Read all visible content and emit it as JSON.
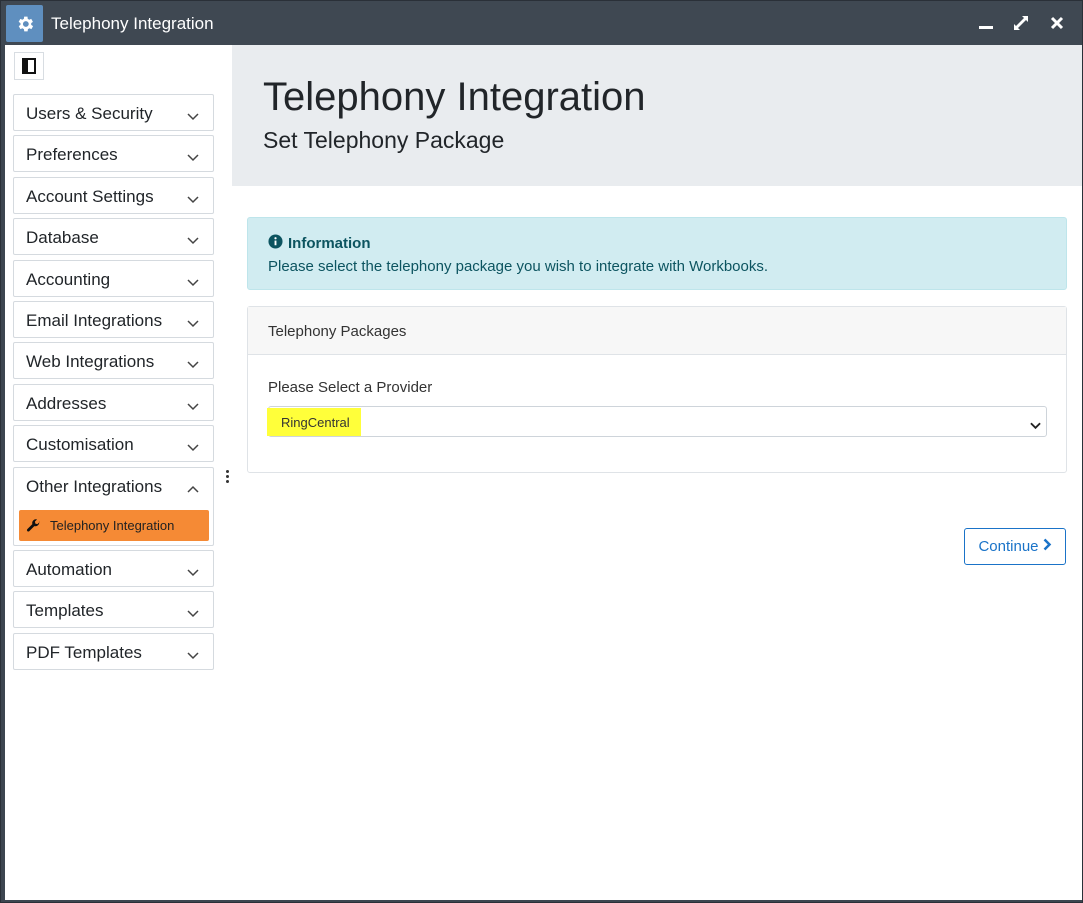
{
  "window": {
    "title": "Telephony Integration"
  },
  "sidebar": {
    "items": [
      {
        "label": "Users & Security"
      },
      {
        "label": "Preferences"
      },
      {
        "label": "Account Settings"
      },
      {
        "label": "Database"
      },
      {
        "label": "Accounting"
      },
      {
        "label": "Email Integrations"
      },
      {
        "label": "Web Integrations"
      },
      {
        "label": "Addresses"
      },
      {
        "label": "Customisation"
      }
    ],
    "expanded_group": {
      "label": "Other Integrations",
      "active_child": "Telephony Integration"
    },
    "items_after": [
      {
        "label": "Automation"
      },
      {
        "label": "Templates"
      },
      {
        "label": "PDF Templates"
      }
    ]
  },
  "main": {
    "title": "Telephony Integration",
    "subtitle": "Set Telephony Package",
    "info": {
      "title": "Information",
      "text": "Please select the telephony package you wish to integrate with Workbooks."
    },
    "card": {
      "header": "Telephony Packages",
      "field_label": "Please Select a Provider",
      "selected_value": "RingCentral"
    },
    "continue_label": "Continue"
  },
  "colors": {
    "accent": "#f58a35",
    "link": "#1a73c8",
    "info_bg": "#d1ecf1",
    "highlight": "#ffff3a"
  },
  "icons": [
    "gear-icon",
    "minimize-icon",
    "maximize-icon",
    "close-icon",
    "sidebar-toggle-icon",
    "chevron-down-icon",
    "chevron-up-icon",
    "wrench-icon",
    "info-circle-icon",
    "kebab-icon",
    "chevron-right-icon"
  ]
}
